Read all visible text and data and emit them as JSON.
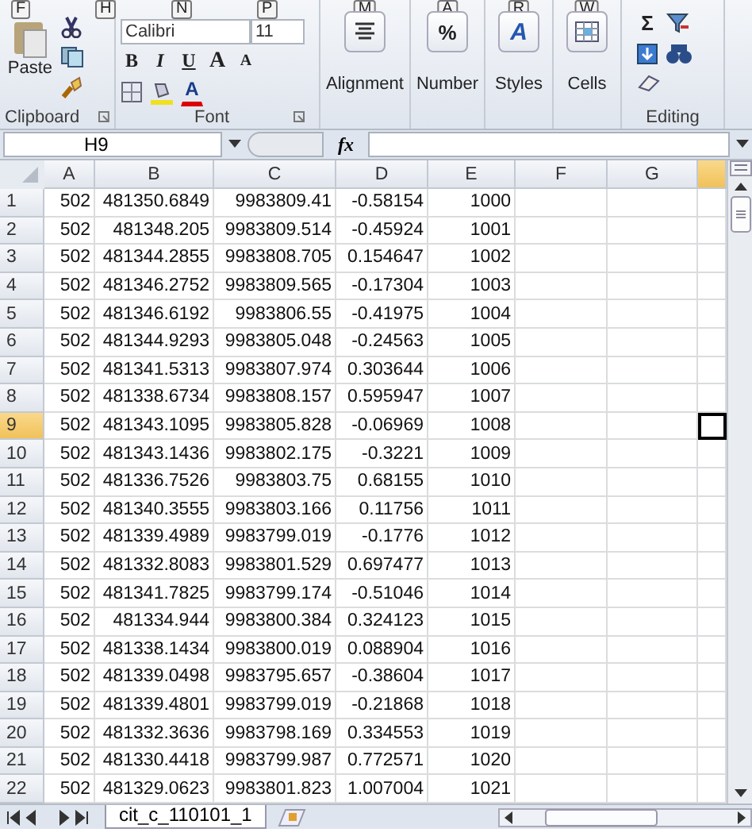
{
  "ribbon": {
    "clipboard": {
      "paste": "Paste",
      "paste_keytip": "F",
      "cut_keytip": "H",
      "label": "Clipboard"
    },
    "font": {
      "name": "Calibri",
      "name_keytip": "N",
      "size": "11",
      "size_keytip": "P",
      "bold": "B",
      "italic": "I",
      "underline": "U",
      "grow": "A",
      "shrink": "A",
      "font_color": "A",
      "label": "Font"
    },
    "big_buttons": [
      {
        "kind": "align",
        "label": "Alignment",
        "keytip": "M"
      },
      {
        "kind": "number",
        "label": "Number",
        "keytip": "A",
        "glyph": "%"
      },
      {
        "kind": "styles",
        "label": "Styles",
        "keytip": "R",
        "glyph": "A"
      },
      {
        "kind": "cells",
        "label": "Cells",
        "keytip": "W"
      }
    ],
    "editing": {
      "sum": "Σ",
      "label": "Editing"
    }
  },
  "formula_bar": {
    "name_box": "H9",
    "fx": "fx"
  },
  "sheet": {
    "columns": [
      "A",
      "B",
      "C",
      "D",
      "E",
      "F",
      "G"
    ],
    "active_column_partial": true,
    "rows": [
      {
        "n": "1",
        "cells": [
          "502",
          "481350.6849",
          "9983809.41",
          "-0.58154",
          "1000"
        ],
        "selected": false
      },
      {
        "n": "2",
        "cells": [
          "502",
          "481348.205",
          "9983809.514",
          "-0.45924",
          "1001"
        ],
        "selected": false
      },
      {
        "n": "3",
        "cells": [
          "502",
          "481344.2855",
          "9983808.705",
          "0.154647",
          "1002"
        ],
        "selected": false
      },
      {
        "n": "4",
        "cells": [
          "502",
          "481346.2752",
          "9983809.565",
          "-0.17304",
          "1003"
        ],
        "selected": false
      },
      {
        "n": "5",
        "cells": [
          "502",
          "481346.6192",
          "9983806.55",
          "-0.41975",
          "1004"
        ],
        "selected": false
      },
      {
        "n": "6",
        "cells": [
          "502",
          "481344.9293",
          "9983805.048",
          "-0.24563",
          "1005"
        ],
        "selected": false
      },
      {
        "n": "7",
        "cells": [
          "502",
          "481341.5313",
          "9983807.974",
          "0.303644",
          "1006"
        ],
        "selected": false
      },
      {
        "n": "8",
        "cells": [
          "502",
          "481338.6734",
          "9983808.157",
          "0.595947",
          "1007"
        ],
        "selected": false
      },
      {
        "n": "9",
        "cells": [
          "502",
          "481343.1095",
          "9983805.828",
          "-0.06969",
          "1008"
        ],
        "selected": true
      },
      {
        "n": "10",
        "cells": [
          "502",
          "481343.1436",
          "9983802.175",
          "-0.3221",
          "1009"
        ],
        "selected": false
      },
      {
        "n": "11",
        "cells": [
          "502",
          "481336.7526",
          "9983803.75",
          "0.68155",
          "1010"
        ],
        "selected": false
      },
      {
        "n": "12",
        "cells": [
          "502",
          "481340.3555",
          "9983803.166",
          "0.11756",
          "1011"
        ],
        "selected": false
      },
      {
        "n": "13",
        "cells": [
          "502",
          "481339.4989",
          "9983799.019",
          "-0.1776",
          "1012"
        ],
        "selected": false
      },
      {
        "n": "14",
        "cells": [
          "502",
          "481332.8083",
          "9983801.529",
          "0.697477",
          "1013"
        ],
        "selected": false
      },
      {
        "n": "15",
        "cells": [
          "502",
          "481341.7825",
          "9983799.174",
          "-0.51046",
          "1014"
        ],
        "selected": false
      },
      {
        "n": "16",
        "cells": [
          "502",
          "481334.944",
          "9983800.384",
          "0.324123",
          "1015"
        ],
        "selected": false
      },
      {
        "n": "17",
        "cells": [
          "502",
          "481338.1434",
          "9983800.019",
          "0.088904",
          "1016"
        ],
        "selected": false
      },
      {
        "n": "18",
        "cells": [
          "502",
          "481339.0498",
          "9983795.657",
          "-0.38604",
          "1017"
        ],
        "selected": false
      },
      {
        "n": "19",
        "cells": [
          "502",
          "481339.4801",
          "9983799.019",
          "-0.21868",
          "1018"
        ],
        "selected": false
      },
      {
        "n": "20",
        "cells": [
          "502",
          "481332.3636",
          "9983798.169",
          "0.334553",
          "1019"
        ],
        "selected": false
      },
      {
        "n": "21",
        "cells": [
          "502",
          "481330.4418",
          "9983799.987",
          "0.772571",
          "1020"
        ],
        "selected": false
      },
      {
        "n": "22",
        "cells": [
          "502",
          "481329.0623",
          "9983801.823",
          "1.007004",
          "1021"
        ],
        "selected": false
      }
    ]
  },
  "sheet_tabs": [
    {
      "label": "cit_c_110101_1",
      "selected": true
    }
  ]
}
